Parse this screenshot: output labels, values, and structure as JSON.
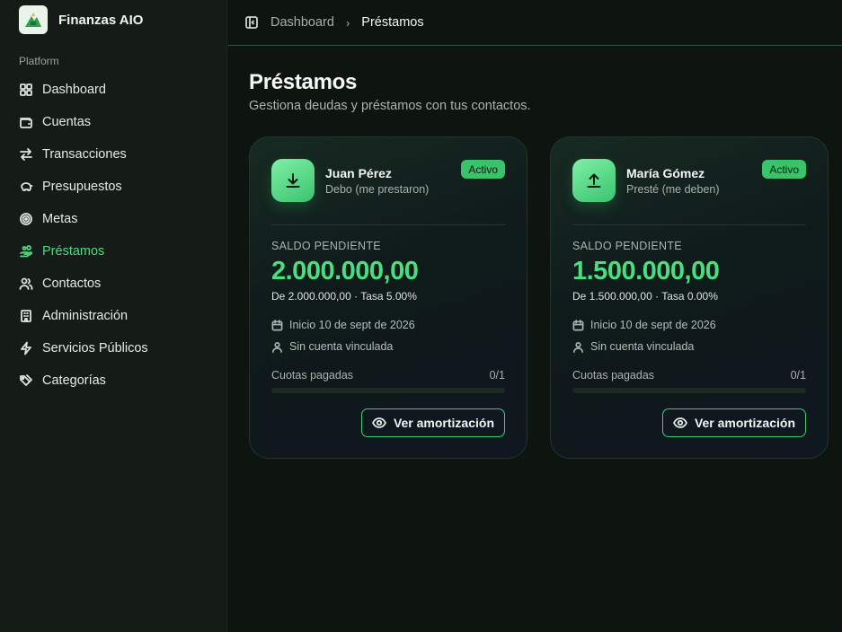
{
  "app": {
    "name": "Finanzas AIO"
  },
  "sidebar": {
    "group_label": "Platform",
    "items": [
      {
        "label": "Dashboard",
        "icon": "grid-icon",
        "active": false
      },
      {
        "label": "Cuentas",
        "icon": "wallet-icon",
        "active": false
      },
      {
        "label": "Transacciones",
        "icon": "arrows-left-right-icon",
        "active": false
      },
      {
        "label": "Presupuestos",
        "icon": "piggy-bank-icon",
        "active": false
      },
      {
        "label": "Metas",
        "icon": "target-icon",
        "active": true
      },
      {
        "label": "Préstamos",
        "icon": "hand-coins-icon",
        "active": true
      },
      {
        "label": "Contactos",
        "icon": "users-icon",
        "active": false
      },
      {
        "label": "Administración",
        "icon": "building-icon",
        "active": false
      },
      {
        "label": "Servicios Públicos",
        "icon": "zap-icon",
        "active": false
      },
      {
        "label": "Categorías",
        "icon": "tags-icon",
        "active": false
      }
    ]
  },
  "header": {
    "breadcrumb": [
      "Dashboard",
      "Préstamos"
    ]
  },
  "page": {
    "title": "Préstamos",
    "subtitle": "Gestiona deudas y préstamos con tus contactos."
  },
  "loans": [
    {
      "name": "Juan Pérez",
      "role": "Debo (me prestaron)",
      "direction": "download-icon",
      "status": "Activo",
      "balance_label": "SALDO PENDIENTE",
      "balance": "2.000.000,00",
      "detail": "De 2.000.000,00 · Tasa 5.00%",
      "start": "Inicio 10 de sept de 2026",
      "account": "Sin cuenta vinculada",
      "quota_label": "Cuotas pagadas",
      "quota_count": "0/1",
      "progress": 0,
      "button": "Ver amortización"
    },
    {
      "name": "María Gómez",
      "role": "Presté (me deben)",
      "direction": "upload-icon",
      "status": "Activo",
      "balance_label": "SALDO PENDIENTE",
      "balance": "1.500.000,00",
      "detail": "De 1.500.000,00 · Tasa 0.00%",
      "start": "Inicio 10 de sept de 2026",
      "account": "Sin cuenta vinculada",
      "quota_label": "Cuotas pagadas",
      "quota_count": "0/1",
      "progress": 0,
      "button": "Ver amortización"
    }
  ],
  "colors": {
    "accent": "#4ade80",
    "badge": "#39c46a"
  }
}
